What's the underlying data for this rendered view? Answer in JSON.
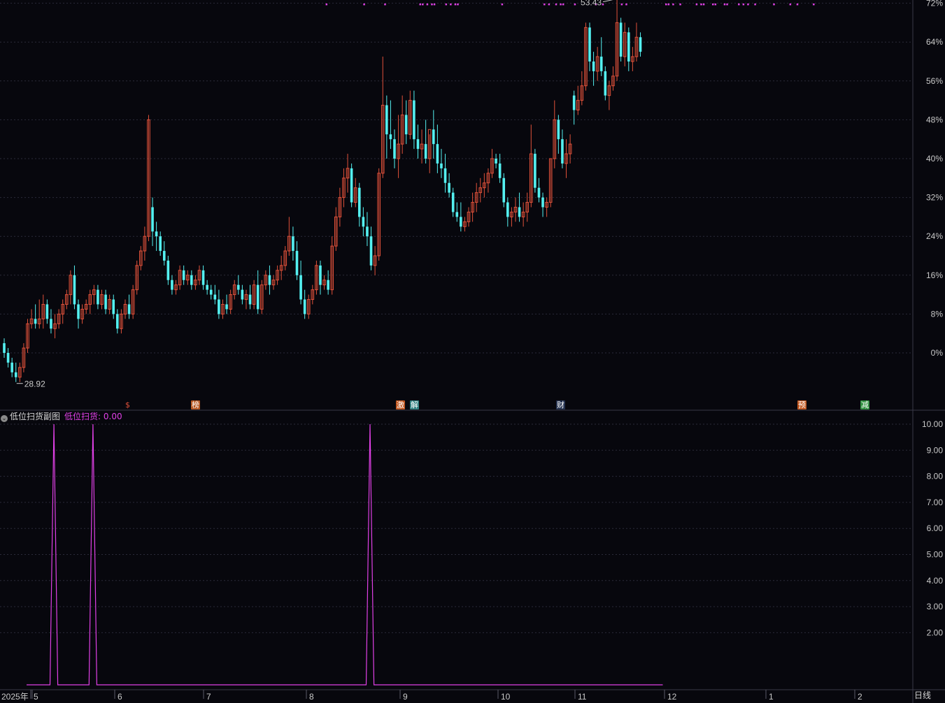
{
  "colors": {
    "background": "#07070d",
    "up": "#e0513a",
    "down": "#54f0f0",
    "indicator": "#e040e6",
    "grid": "#2b2b3a",
    "axis_text": "#c9c9c9"
  },
  "price_chart": {
    "high_label": "53.43",
    "low_label": "28.92",
    "y_axis_labels": [
      "72%",
      "64%",
      "56%",
      "48%",
      "40%",
      "32%",
      "24%",
      "16%",
      "8%",
      "0%"
    ],
    "event_markers": [
      {
        "text": "$",
        "color": "#e0513a",
        "icon": "dollar-icon"
      },
      {
        "text": "榜",
        "color": "#b5551f"
      },
      {
        "text": "激",
        "color": "#c0561f"
      },
      {
        "text": "解",
        "color": "#2f7f7f"
      },
      {
        "text": "财",
        "color": "#23304e"
      },
      {
        "text": "预",
        "color": "#c0561f"
      },
      {
        "text": "减",
        "color": "#2f8f3f"
      }
    ]
  },
  "indicator_panel": {
    "name": "低位扫货副图",
    "series_label": "低位扫货: 0.00",
    "y_axis_labels": [
      "10.00",
      "9.00",
      "8.00",
      "7.00",
      "6.00",
      "5.00",
      "4.00",
      "3.00",
      "2.00"
    ]
  },
  "x_axis_labels": [
    "2025年",
    "5",
    "6",
    "7",
    "8",
    "9",
    "10",
    "11",
    "12",
    "1",
    "2"
  ],
  "period_label": "日线",
  "chart_data": [
    {
      "type": "candlestick",
      "title": "",
      "y_unit": "percent change from 28.92",
      "ylim": [
        -6,
        74
      ],
      "y_ticks": [
        0,
        8,
        16,
        24,
        32,
        40,
        48,
        56,
        64,
        72
      ],
      "x_ticks": [
        "2025年",
        "5",
        "6",
        "7",
        "8",
        "9",
        "10",
        "11",
        "12",
        "1",
        "2"
      ],
      "annotations": {
        "max": "53.43",
        "min": "28.92"
      },
      "grid": true,
      "ohlc": [
        [
          2,
          3,
          -1,
          0
        ],
        [
          0,
          1,
          -3,
          -2
        ],
        [
          -2,
          -1,
          -5,
          -4
        ],
        [
          -4,
          -2,
          -6,
          -5
        ],
        [
          -5,
          -2,
          -6,
          -3
        ],
        [
          -3,
          2,
          -4,
          1
        ],
        [
          1,
          7,
          0,
          6
        ],
        [
          6,
          9,
          5,
          7
        ],
        [
          7,
          10,
          5,
          6
        ],
        [
          6,
          11,
          5,
          7
        ],
        [
          7,
          12,
          5,
          10
        ],
        [
          10,
          11,
          6,
          7
        ],
        [
          7,
          9,
          4,
          5
        ],
        [
          5,
          8,
          3,
          6
        ],
        [
          6,
          9,
          5,
          8
        ],
        [
          8,
          11,
          6,
          10
        ],
        [
          10,
          13,
          9,
          12
        ],
        [
          12,
          17,
          10,
          16
        ],
        [
          16,
          18,
          9,
          10
        ],
        [
          10,
          11,
          5,
          7
        ],
        [
          7,
          10,
          6,
          9
        ],
        [
          9,
          11,
          8,
          10
        ],
        [
          10,
          13,
          8,
          12
        ],
        [
          12,
          14,
          10,
          13
        ],
        [
          13,
          14,
          9,
          10
        ],
        [
          10,
          13,
          9,
          12
        ],
        [
          12,
          13,
          8,
          9
        ],
        [
          9,
          12,
          8,
          11
        ],
        [
          11,
          12,
          7,
          8
        ],
        [
          8,
          9,
          4,
          5
        ],
        [
          5,
          9,
          4,
          8
        ],
        [
          8,
          11,
          7,
          10
        ],
        [
          10,
          12,
          7,
          8
        ],
        [
          8,
          14,
          7,
          13
        ],
        [
          13,
          19,
          12,
          18
        ],
        [
          18,
          22,
          17,
          21
        ],
        [
          21,
          26,
          19,
          24
        ],
        [
          24,
          49,
          23,
          48
        ],
        [
          30,
          32,
          22,
          25
        ],
        [
          25,
          27,
          21,
          24
        ],
        [
          24,
          25,
          20,
          21
        ],
        [
          21,
          23,
          18,
          19
        ],
        [
          19,
          20,
          14,
          15
        ],
        [
          15,
          16,
          12,
          13
        ],
        [
          13,
          15,
          12,
          14
        ],
        [
          14,
          18,
          13,
          17
        ],
        [
          17,
          18,
          14,
          15
        ],
        [
          15,
          17,
          14,
          16
        ],
        [
          16,
          17,
          13,
          14
        ],
        [
          14,
          16,
          13,
          15
        ],
        [
          15,
          18,
          14,
          17
        ],
        [
          17,
          18,
          13,
          14
        ],
        [
          14,
          15,
          12,
          13
        ],
        [
          13,
          14,
          11,
          12
        ],
        [
          12,
          14,
          10,
          11
        ],
        [
          11,
          13,
          7,
          8
        ],
        [
          8,
          11,
          7,
          10
        ],
        [
          10,
          12,
          8,
          9
        ],
        [
          9,
          13,
          8,
          12
        ],
        [
          12,
          15,
          11,
          14
        ],
        [
          14,
          16,
          12,
          13
        ],
        [
          13,
          14,
          10,
          11
        ],
        [
          11,
          13,
          9,
          12
        ],
        [
          12,
          14,
          9,
          10
        ],
        [
          10,
          15,
          9,
          14
        ],
        [
          14,
          17,
          8,
          9
        ],
        [
          9,
          15,
          8,
          14
        ],
        [
          14,
          17,
          13,
          16
        ],
        [
          16,
          18,
          12,
          14
        ],
        [
          14,
          16,
          13,
          15
        ],
        [
          15,
          18,
          14,
          17
        ],
        [
          17,
          20,
          15,
          18
        ],
        [
          18,
          22,
          17,
          21
        ],
        [
          21,
          28,
          20,
          24
        ],
        [
          24,
          26,
          19,
          21
        ],
        [
          21,
          23,
          15,
          16
        ],
        [
          16,
          19,
          10,
          11
        ],
        [
          11,
          13,
          7,
          8
        ],
        [
          8,
          12,
          7,
          11
        ],
        [
          11,
          14,
          10,
          13
        ],
        [
          13,
          19,
          12,
          18
        ],
        [
          18,
          19,
          12,
          14
        ],
        [
          14,
          16,
          13,
          15
        ],
        [
          15,
          17,
          12,
          13
        ],
        [
          13,
          24,
          12,
          22
        ],
        [
          22,
          30,
          21,
          28
        ],
        [
          28,
          34,
          26,
          32
        ],
        [
          32,
          38,
          30,
          36
        ],
        [
          36,
          41,
          33,
          38
        ],
        [
          38,
          39,
          30,
          31
        ],
        [
          31,
          36,
          30,
          34
        ],
        [
          34,
          35,
          26,
          28
        ],
        [
          28,
          30,
          24,
          26
        ],
        [
          26,
          29,
          22,
          24
        ],
        [
          24,
          26,
          17,
          18
        ],
        [
          18,
          22,
          16,
          20
        ],
        [
          20,
          38,
          19,
          37
        ],
        [
          37,
          61,
          36,
          51
        ],
        [
          51,
          53,
          40,
          45
        ],
        [
          45,
          52,
          42,
          44
        ],
        [
          44,
          46,
          38,
          40
        ],
        [
          40,
          49,
          36,
          43
        ],
        [
          43,
          53,
          41,
          49
        ],
        [
          49,
          52,
          43,
          45
        ],
        [
          45,
          54,
          44,
          52
        ],
        [
          52,
          54,
          42,
          44
        ],
        [
          44,
          47,
          40,
          42
        ],
        [
          42,
          46,
          39,
          43
        ],
        [
          43,
          48,
          39,
          40
        ],
        [
          40,
          45,
          37,
          46
        ],
        [
          46,
          50,
          40,
          43
        ],
        [
          43,
          47,
          37,
          39
        ],
        [
          39,
          42,
          36,
          38
        ],
        [
          38,
          41,
          33,
          35
        ],
        [
          35,
          37,
          32,
          33
        ],
        [
          33,
          34,
          28,
          29
        ],
        [
          29,
          31,
          27,
          28
        ],
        [
          28,
          31,
          25,
          26
        ],
        [
          26,
          28,
          25,
          27
        ],
        [
          27,
          30,
          26,
          29
        ],
        [
          29,
          33,
          27,
          31
        ],
        [
          31,
          35,
          29,
          33
        ],
        [
          33,
          36,
          31,
          34
        ],
        [
          34,
          37,
          32,
          35
        ],
        [
          35,
          38,
          33,
          37
        ],
        [
          37,
          42,
          36,
          40
        ],
        [
          40,
          41,
          38,
          39
        ],
        [
          39,
          41,
          35,
          36
        ],
        [
          36,
          37,
          30,
          31
        ],
        [
          31,
          32,
          26,
          28
        ],
        [
          28,
          30,
          26,
          29
        ],
        [
          29,
          32,
          27,
          30
        ],
        [
          30,
          33,
          27,
          28
        ],
        [
          28,
          31,
          26,
          29
        ],
        [
          29,
          33,
          27,
          31
        ],
        [
          31,
          47,
          30,
          41
        ],
        [
          41,
          42,
          33,
          34
        ],
        [
          34,
          36,
          31,
          32
        ],
        [
          32,
          33,
          28,
          30
        ],
        [
          30,
          32,
          28,
          31
        ],
        [
          31,
          40,
          30,
          40
        ],
        [
          40,
          52,
          38,
          48
        ],
        [
          48,
          49,
          41,
          44
        ],
        [
          44,
          46,
          38,
          39
        ],
        [
          39,
          44,
          36,
          41
        ],
        [
          41,
          45,
          39,
          43
        ],
        [
          53,
          54,
          47,
          50
        ],
        [
          50,
          55,
          49,
          52
        ],
        [
          52,
          58,
          51,
          55
        ],
        [
          55,
          68,
          54,
          67
        ],
        [
          67,
          68,
          58,
          60
        ],
        [
          60,
          62,
          55,
          58
        ],
        [
          58,
          63,
          56,
          61
        ],
        [
          61,
          65,
          57,
          58
        ],
        [
          58,
          59,
          52,
          53
        ],
        [
          53,
          56,
          50,
          55
        ],
        [
          55,
          59,
          54,
          57
        ],
        [
          57,
          73,
          56,
          68
        ],
        [
          68,
          69,
          60,
          61
        ],
        [
          61,
          68,
          59,
          66
        ],
        [
          66,
          67,
          58,
          60
        ],
        [
          60,
          63,
          58,
          61
        ],
        [
          61,
          68,
          60,
          65
        ],
        [
          65,
          66,
          61,
          62
        ]
      ]
    },
    {
      "type": "line",
      "title": "低位扫货副图",
      "series": [
        {
          "name": "低位扫货",
          "values_nonzero": {
            "index": [
              7,
              17,
              88,
              222
            ],
            "value": 10
          }
        }
      ],
      "ylim": [
        0,
        10.5
      ],
      "y_ticks": [
        2,
        3,
        4,
        5,
        6,
        7,
        8,
        9,
        10
      ],
      "grid": true
    }
  ]
}
